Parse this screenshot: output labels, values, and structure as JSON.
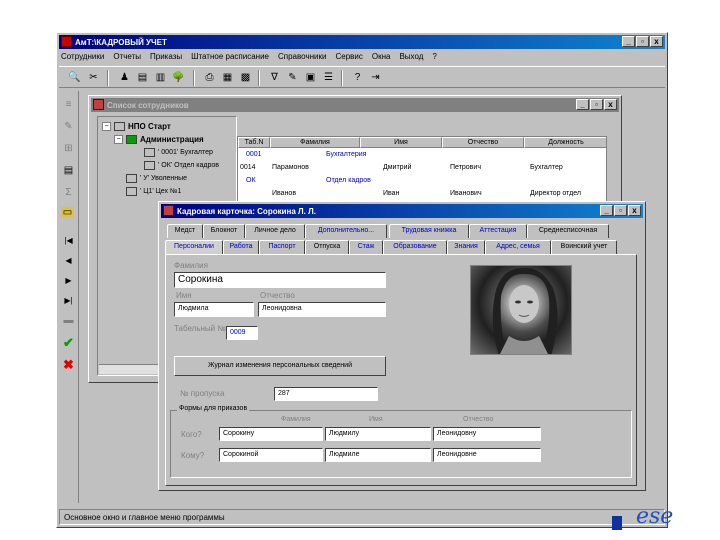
{
  "main": {
    "title": "АмТ:\\КАДРОВЫЙ УЧЕТ",
    "menu": [
      "Сотрудники",
      "Отчеты",
      "Приказы",
      "Штатное расписание",
      "Справочники",
      "Сервис",
      "Окна",
      "Выход",
      "?"
    ],
    "status": "Основное окно и главное меню программы",
    "controls": [
      "_",
      "▫",
      "x"
    ]
  },
  "toolbar": {
    "icons": [
      "search-person-icon",
      "scissors-icon",
      "person-icon",
      "card-icon",
      "report-icon",
      "tree-icon",
      "print-icon",
      "table-icon",
      "grid-icon",
      "filter-icon",
      "edit-icon",
      "form-icon",
      "list-icon",
      "help-icon",
      "exit-icon"
    ],
    "glyphs": [
      "🔍",
      "✂",
      "♟",
      "▤",
      "▥",
      "🌳",
      "⎙",
      "▦",
      "▩",
      "∇",
      "✎",
      "▣",
      "☰",
      "?",
      "⇥"
    ]
  },
  "left_toolbar": {
    "glyphs": [
      "≡",
      "✎",
      "⊞",
      "▤",
      "Σ",
      "▭",
      "|◀",
      "◀",
      "▶",
      "▶|",
      "▬",
      "✔",
      "✖"
    ]
  },
  "list_window": {
    "title": "Список сотрудников",
    "tree": {
      "root": "НПО Старт",
      "items": [
        {
          "label": "Администрация",
          "bold": true
        },
        {
          "label": "' 0001' Бухгалтер"
        },
        {
          "label": "' ОК' Отдел кадров"
        },
        {
          "label": "' У' Уволенные"
        },
        {
          "label": "' Ц1' Цех №1"
        }
      ]
    },
    "grid": {
      "headers": [
        "Таб.N",
        "Фамилия",
        "Имя",
        "Отчество",
        "Должность"
      ],
      "rows": [
        {
          "tab": "0001",
          "group": "Бухгалтерия"
        },
        {
          "tab": "0014",
          "surname": "Парамонов",
          "name": "Дмитрий",
          "patronymic": "Петрович",
          "position": "Бухгалтер"
        },
        {
          "tab": "ОК",
          "group": "Отдел кадров"
        },
        {
          "tab": "",
          "surname": "Иванов",
          "name": "Иван",
          "patronymic": "Иванович",
          "position": "Директор отдел"
        }
      ]
    }
  },
  "card_window": {
    "title": "Кадровая карточка: Сорокина Л. Л.",
    "tabs_row1": [
      "Медст",
      "Блокнот",
      "Личное дело",
      "Дополнительно...",
      "Трудовая книжка",
      "Аттестация",
      "Среднесписочная"
    ],
    "tabs_row2": [
      "Персоналии",
      "Работа",
      "Паспорт",
      "Отпуска",
      "Стаж",
      "Образование",
      "Знания",
      "Адрес, семья",
      "Воинский учет"
    ],
    "labels": {
      "surname": "Фамилия",
      "name": "Имя",
      "patronymic": "Отчество",
      "tab_no": "Табельный №",
      "pass_no": "№ пропуска",
      "forms_group": "Формы для приказов",
      "whom": "Кого?",
      "to_whom": "Кому?"
    },
    "values": {
      "surname": "Сорокина",
      "name": "Людмила",
      "patronymic": "Леонидовна",
      "tab_no": "0009",
      "pass_no": "287"
    },
    "journal_button": "Журнал изменения персональных сведений",
    "forms": {
      "headers": [
        "Фамилия",
        "Имя",
        "Отчество"
      ],
      "whom": [
        "Сорокину",
        "Людмилу",
        "Леонидовну"
      ],
      "to_whom": [
        "Сорокиной",
        "Людмиле",
        "Леонидовне"
      ]
    }
  },
  "logo_text": "ese"
}
